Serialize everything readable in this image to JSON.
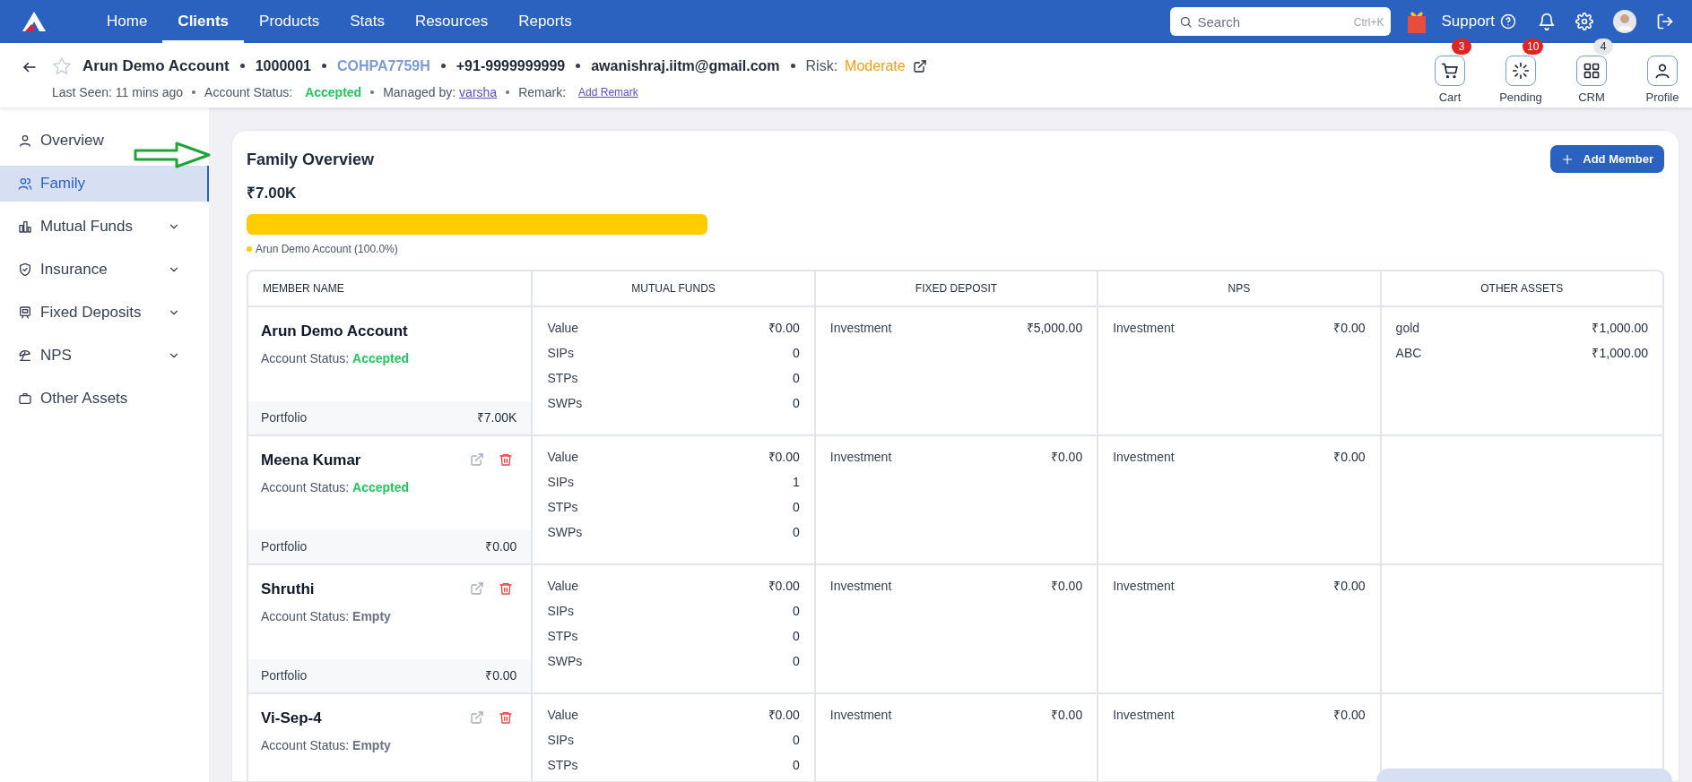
{
  "nav": {
    "tabs": [
      {
        "label": "Home",
        "selected": false
      },
      {
        "label": "Clients",
        "selected": true
      },
      {
        "label": "Products",
        "selected": false
      },
      {
        "label": "Stats",
        "selected": false
      },
      {
        "label": "Resources",
        "selected": false
      },
      {
        "label": "Reports",
        "selected": false
      }
    ],
    "search": {
      "placeholder": "Search",
      "shortcut": "Ctrl+K"
    },
    "support": "Support"
  },
  "client": {
    "name": "Arun Demo Account",
    "code": "1000001",
    "pan": "COHPA7759H",
    "phone": "+91-9999999999",
    "email": "awanishraj.iitm@gmail.com",
    "risk_label": "Risk:",
    "risk": "Moderate",
    "last_seen": "Last Seen: 11 mins ago",
    "status_label": "Account Status:",
    "status": "Accepted",
    "managed_label": "Managed by:",
    "manager": "varsha",
    "remark_label": "Remark:",
    "remark_link": "Add Remark"
  },
  "actions": [
    {
      "label": "Cart",
      "badge": "3",
      "color": "#dc2626"
    },
    {
      "label": "Pending",
      "badge": "10",
      "color": "#dc2626"
    },
    {
      "label": "CRM",
      "badge": "4",
      "color": "#e5e7eb"
    },
    {
      "label": "Profile"
    }
  ],
  "sidebar": {
    "items": [
      {
        "label": "Overview",
        "selected": false,
        "has_submenu": false
      },
      {
        "label": "Family",
        "selected": true,
        "has_submenu": false
      },
      {
        "label": "Mutual Funds",
        "selected": false,
        "has_submenu": true
      },
      {
        "label": "Insurance",
        "selected": false,
        "has_submenu": true
      },
      {
        "label": "Fixed Deposits",
        "selected": false,
        "has_submenu": true
      },
      {
        "label": "NPS",
        "selected": false,
        "has_submenu": true
      },
      {
        "label": "Other Assets",
        "selected": false,
        "has_submenu": false
      }
    ]
  },
  "family": {
    "title": "Family Overview",
    "add_button": "Add Member",
    "total": "₹7.00K",
    "bar": [
      {
        "level": 1,
        "color": "#ffcc00",
        "legend": "Arun Demo Account (100.0%)"
      }
    ],
    "columns": [
      "MEMBER NAME",
      "MUTUAL FUNDS",
      "FIXED DEPOSIT",
      "NPS",
      "OTHER ASSETS"
    ],
    "rows": [
      {
        "name": "Arun Demo Account",
        "has_actions": false,
        "status_label": "Account Status:",
        "status": {
          "text": "Accepted",
          "color": "#22c55e"
        },
        "portfolio_label": "Portfolio",
        "portfolio_value": "₹7.00K",
        "mutual_funds": [
          {
            "label": "Value",
            "value": "₹0.00"
          },
          {
            "label": "SIPs",
            "value": "0"
          },
          {
            "label": "STPs",
            "value": "0"
          },
          {
            "label": "SWPs",
            "value": "0"
          }
        ],
        "fixed_deposit": [
          {
            "label": "Investment",
            "value": "₹5,000.00"
          }
        ],
        "nps": [
          {
            "label": "Investment",
            "value": "₹0.00"
          }
        ],
        "other_assets": [
          {
            "label": "gold",
            "value": "₹1,000.00"
          },
          {
            "label": "ABC",
            "value": "₹1,000.00"
          }
        ]
      },
      {
        "name": "Meena Kumar",
        "has_actions": true,
        "status_label": "Account Status:",
        "status": {
          "text": "Accepted",
          "color": "#22c55e"
        },
        "portfolio_label": "Portfolio",
        "portfolio_value": "₹0.00",
        "mutual_funds": [
          {
            "label": "Value",
            "value": "₹0.00"
          },
          {
            "label": "SIPs",
            "value": "1"
          },
          {
            "label": "STPs",
            "value": "0"
          },
          {
            "label": "SWPs",
            "value": "0"
          }
        ],
        "fixed_deposit": [
          {
            "label": "Investment",
            "value": "₹0.00"
          }
        ],
        "nps": [
          {
            "label": "Investment",
            "value": "₹0.00"
          }
        ],
        "other_assets": []
      },
      {
        "name": "Shruthi",
        "has_actions": true,
        "status_label": "Account Status:",
        "status": {
          "text": "Empty",
          "color": "#6b7280"
        },
        "portfolio_label": "Portfolio",
        "portfolio_value": "₹0.00",
        "mutual_funds": [
          {
            "label": "Value",
            "value": "₹0.00"
          },
          {
            "label": "SIPs",
            "value": "0"
          },
          {
            "label": "STPs",
            "value": "0"
          },
          {
            "label": "SWPs",
            "value": "0"
          }
        ],
        "fixed_deposit": [
          {
            "label": "Investment",
            "value": "₹0.00"
          }
        ],
        "nps": [
          {
            "label": "Investment",
            "value": "₹0.00"
          }
        ],
        "other_assets": []
      },
      {
        "name": "Vi-Sep-4",
        "has_actions": true,
        "status_label": "Account Status:",
        "status": {
          "text": "Empty",
          "color": "#6b7280"
        },
        "mutual_funds": [
          {
            "label": "Value",
            "value": "₹0.00"
          },
          {
            "label": "SIPs",
            "value": "0"
          },
          {
            "label": "STPs",
            "value": "0"
          }
        ],
        "fixed_deposit": [
          {
            "label": "Investment",
            "value": "₹0.00"
          }
        ],
        "nps": [
          {
            "label": "Investment",
            "value": "₹0.00"
          }
        ],
        "other_assets": []
      }
    ]
  }
}
